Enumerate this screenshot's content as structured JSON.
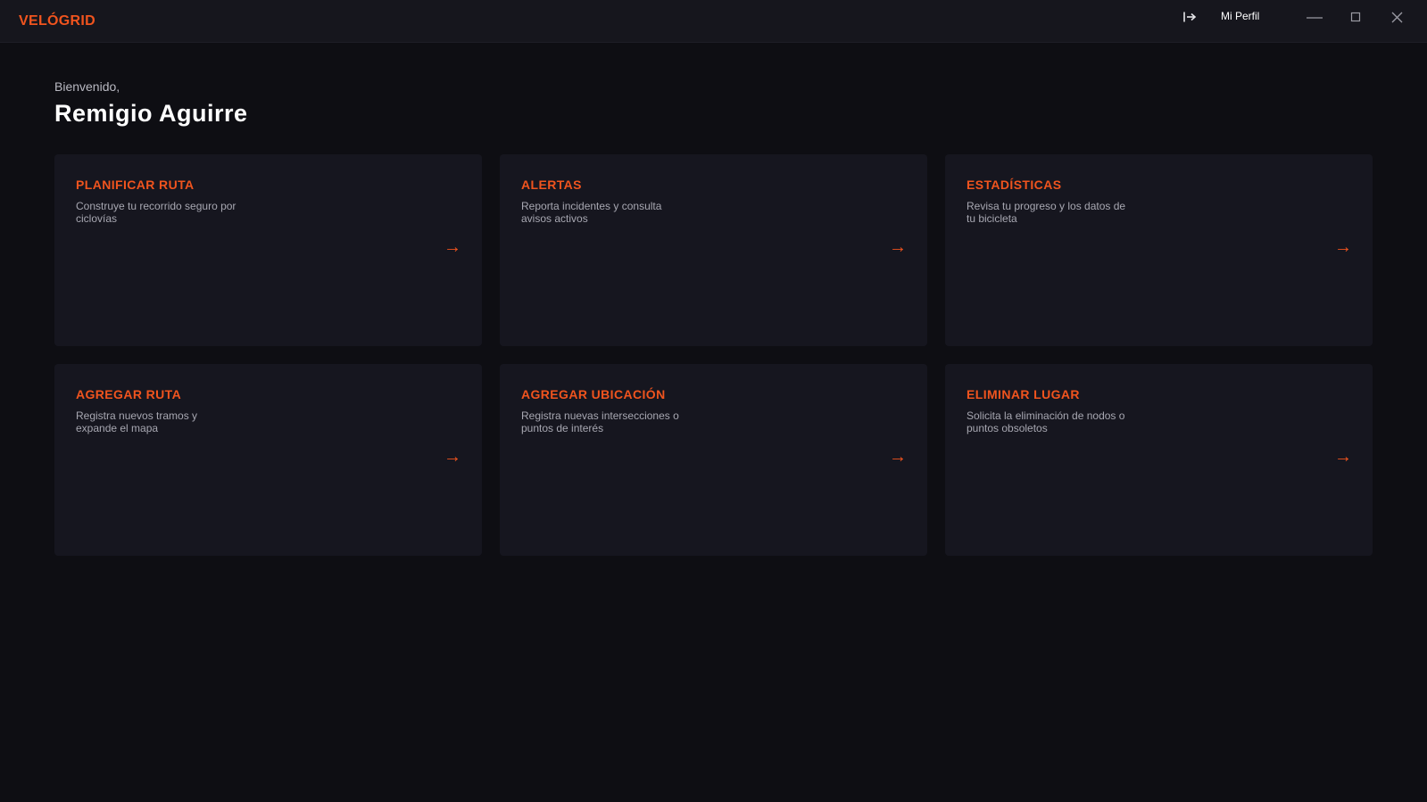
{
  "app": {
    "brand": "VELÓGRID",
    "profile_label": "Mi Perfil",
    "accent_color": "#f0541e"
  },
  "icons": {
    "logout": "logout-icon",
    "minimize": "minimize-icon",
    "maximize": "maximize-icon",
    "close": "close-icon",
    "arrow": "→"
  },
  "welcome": {
    "greeting": "Bienvenido,",
    "user_name": "Remigio Aguirre"
  },
  "cards": [
    {
      "title": "PLANIFICAR RUTA",
      "description": "Construye tu recorrido seguro por ciclovías",
      "arrow": "→"
    },
    {
      "title": "ALERTAS",
      "description": "Reporta incidentes y consulta avisos activos",
      "arrow": "→"
    },
    {
      "title": "ESTADÍSTICAS",
      "description": "Revisa tu progreso y los datos de tu bicicleta",
      "arrow": "→"
    },
    {
      "title": "AGREGAR RUTA",
      "description": "Registra nuevos tramos y expande el mapa",
      "arrow": "→"
    },
    {
      "title": "AGREGAR UBICACIÓN",
      "description": "Registra nuevas intersecciones o puntos de interés",
      "arrow": "→"
    },
    {
      "title": "ELIMINAR LUGAR",
      "description": "Solicita la eliminación de nodos o puntos obsoletos",
      "arrow": "→"
    }
  ]
}
